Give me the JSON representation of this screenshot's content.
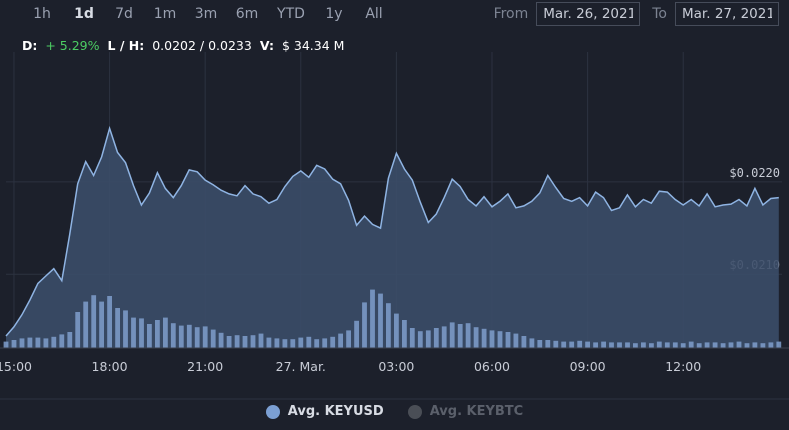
{
  "range_buttons": [
    "1h",
    "1d",
    "7d",
    "1m",
    "3m",
    "6m",
    "YTD",
    "1y",
    "All"
  ],
  "active_range": "1d",
  "date_range": {
    "from_label": "From",
    "from_value": "Mar. 26, 2021",
    "to_label": "To",
    "to_value": "Mar. 27, 2021"
  },
  "stats": {
    "d_label": "D:",
    "d_value": "+ 5.29%",
    "lh_label": "L / H:",
    "lh_value": "0.0202 / 0.0233",
    "v_label": "V:",
    "v_value": "$ 34.34 M"
  },
  "colors": {
    "line": "#8fb4e3",
    "fill": "#3b4d68",
    "volume": "#7f9fcc",
    "up": "#4ccd63",
    "grid": "#2c3240",
    "legend_active": "#7b9fd3",
    "legend_inactive": "#4a4e56"
  },
  "legend": [
    {
      "label": "Avg. KEYUSD",
      "active": true
    },
    {
      "label": "Avg. KEYBTC",
      "active": false
    }
  ],
  "chart_data": {
    "type": "area",
    "x_ticks": [
      "15:00",
      "18:00",
      "21:00",
      "27. Mar.",
      "03:00",
      "06:00",
      "09:00",
      "12:00"
    ],
    "x_tick_hours": [
      0,
      3,
      6,
      9,
      12,
      15,
      18,
      21
    ],
    "y_ticks": [
      0.021,
      0.022
    ],
    "y_tick_labels": [
      "$0.0210",
      "$0.0220"
    ],
    "ylim": [
      0.0202,
      0.0233
    ],
    "xlim_hours": [
      -0.25,
      24.1
    ],
    "series": [
      {
        "name": "Avg. KEYUSD",
        "x_hours": [
          -0.25,
          0.0,
          0.25,
          0.5,
          0.75,
          1.0,
          1.25,
          1.5,
          1.75,
          2.0,
          2.25,
          2.5,
          2.75,
          3.0,
          3.25,
          3.5,
          3.75,
          4.0,
          4.25,
          4.5,
          4.75,
          5.0,
          5.25,
          5.5,
          5.75,
          6.0,
          6.25,
          6.5,
          6.75,
          7.0,
          7.25,
          7.5,
          7.75,
          8.0,
          8.25,
          8.5,
          8.75,
          9.0,
          9.25,
          9.5,
          9.75,
          10.0,
          10.25,
          10.5,
          10.75,
          11.0,
          11.25,
          11.5,
          11.75,
          12.0,
          12.25,
          12.5,
          12.75,
          13.0,
          13.25,
          13.5,
          13.75,
          14.0,
          14.25,
          14.5,
          14.75,
          15.0,
          15.25,
          15.5,
          15.75,
          16.0,
          16.25,
          16.5,
          16.75,
          17.0,
          17.25,
          17.5,
          17.75,
          18.0,
          18.25,
          18.5,
          18.75,
          19.0,
          19.25,
          19.5,
          19.75,
          20.0,
          20.25,
          20.5,
          20.75,
          21.0,
          21.25,
          21.5,
          21.75,
          22.0,
          22.25,
          22.5,
          22.75,
          23.0,
          23.25,
          23.5,
          23.75,
          24.0
        ],
        "values": [
          0.02033,
          0.02043,
          0.02056,
          0.02072,
          0.0209,
          0.02098,
          0.02106,
          0.02093,
          0.02143,
          0.02198,
          0.02222,
          0.02207,
          0.02227,
          0.02258,
          0.02232,
          0.02221,
          0.02196,
          0.02175,
          0.02188,
          0.0221,
          0.02193,
          0.02183,
          0.02196,
          0.02213,
          0.02211,
          0.02202,
          0.02197,
          0.02191,
          0.02187,
          0.02185,
          0.02196,
          0.02187,
          0.02184,
          0.02177,
          0.02181,
          0.02195,
          0.02206,
          0.02212,
          0.02205,
          0.02218,
          0.02214,
          0.02203,
          0.02198,
          0.0218,
          0.02153,
          0.02163,
          0.02154,
          0.0215,
          0.02204,
          0.02231,
          0.02214,
          0.02202,
          0.02178,
          0.02156,
          0.02165,
          0.02183,
          0.02203,
          0.02195,
          0.02181,
          0.02174,
          0.02184,
          0.02173,
          0.02179,
          0.02187,
          0.02172,
          0.02174,
          0.02179,
          0.02188,
          0.02207,
          0.02194,
          0.02182,
          0.02179,
          0.02183,
          0.02174,
          0.02189,
          0.02183,
          0.02169,
          0.02172,
          0.02186,
          0.02173,
          0.02181,
          0.02177,
          0.0219,
          0.02189,
          0.02181,
          0.02175,
          0.02181,
          0.02174,
          0.02187,
          0.02173,
          0.02175,
          0.02176,
          0.02181,
          0.02174,
          0.02193,
          0.02175,
          0.02182,
          0.02183,
          0.02193,
          0.02206,
          0.02198,
          0.02193
        ]
      }
    ],
    "volume": {
      "x_hours": [
        -0.25,
        0.0,
        0.25,
        0.5,
        0.75,
        1.0,
        1.25,
        1.5,
        1.75,
        2.0,
        2.25,
        2.5,
        2.75,
        3.0,
        3.25,
        3.5,
        3.75,
        4.0,
        4.25,
        4.5,
        4.75,
        5.0,
        5.25,
        5.5,
        5.75,
        6.0,
        6.25,
        6.5,
        6.75,
        7.0,
        7.25,
        7.5,
        7.75,
        8.0,
        8.25,
        8.5,
        8.75,
        9.0,
        9.25,
        9.5,
        9.75,
        10.0,
        10.25,
        10.5,
        10.75,
        11.0,
        11.25,
        11.5,
        11.75,
        12.0,
        12.25,
        12.5,
        12.75,
        13.0,
        13.25,
        13.5,
        13.75,
        14.0,
        14.25,
        14.5,
        14.75,
        15.0,
        15.25,
        15.5,
        15.75,
        16.0,
        16.25,
        16.5,
        16.75,
        17.0,
        17.25,
        17.5,
        17.75,
        18.0,
        18.25,
        18.5,
        18.75,
        19.0,
        19.25,
        19.5,
        19.75,
        20.0,
        20.25,
        20.5,
        20.75,
        21.0,
        21.25,
        21.5,
        21.75,
        22.0,
        22.25,
        22.5,
        22.75,
        23.0,
        23.25,
        23.5,
        23.75,
        24.0
      ],
      "values": [
        0.08,
        0.1,
        0.12,
        0.13,
        0.13,
        0.12,
        0.14,
        0.17,
        0.2,
        0.45,
        0.58,
        0.66,
        0.58,
        0.65,
        0.5,
        0.47,
        0.38,
        0.37,
        0.3,
        0.35,
        0.38,
        0.31,
        0.28,
        0.29,
        0.26,
        0.27,
        0.23,
        0.19,
        0.15,
        0.16,
        0.15,
        0.16,
        0.18,
        0.13,
        0.12,
        0.11,
        0.11,
        0.13,
        0.14,
        0.11,
        0.12,
        0.14,
        0.18,
        0.22,
        0.34,
        0.57,
        0.73,
        0.68,
        0.56,
        0.43,
        0.35,
        0.25,
        0.21,
        0.22,
        0.25,
        0.27,
        0.32,
        0.3,
        0.31,
        0.26,
        0.24,
        0.22,
        0.21,
        0.2,
        0.18,
        0.15,
        0.12,
        0.1,
        0.1,
        0.09,
        0.08,
        0.08,
        0.09,
        0.08,
        0.07,
        0.08,
        0.07,
        0.07,
        0.07,
        0.06,
        0.07,
        0.06,
        0.08,
        0.07,
        0.07,
        0.06,
        0.08,
        0.06,
        0.07,
        0.07,
        0.06,
        0.07,
        0.08,
        0.06,
        0.07,
        0.06,
        0.07,
        0.08,
        0.07,
        0.08,
        0.07,
        0.06
      ]
    },
    "grid": true,
    "legend_position": "bottom"
  }
}
